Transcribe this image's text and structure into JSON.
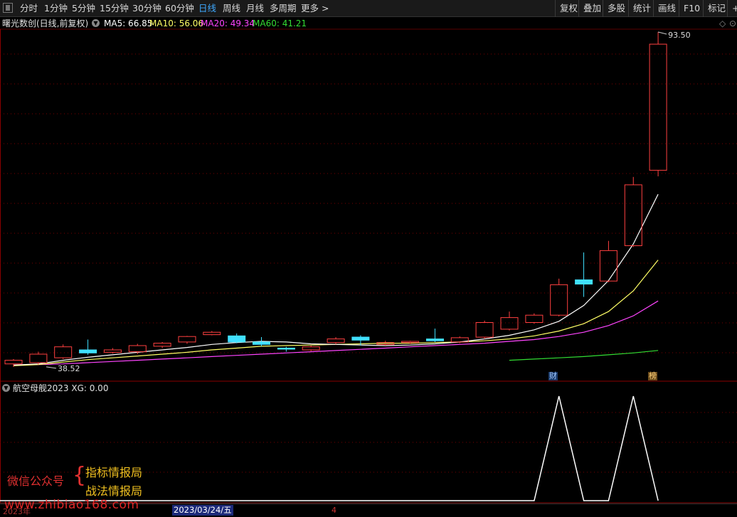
{
  "toolbar": {
    "periods": [
      "分时",
      "1分钟",
      "5分钟",
      "15分钟",
      "30分钟",
      "60分钟",
      "日线",
      "周线",
      "月线",
      "多周期",
      "更多 >"
    ],
    "active_period": "日线",
    "right_buttons": [
      "复权",
      "叠加",
      "多股",
      "统计",
      "画线",
      "F10",
      "标记",
      "+"
    ]
  },
  "stock": {
    "title": "曙光数创(日线,前复权)",
    "ma5": "MA5: 66.85",
    "ma10": "MA10: 56.06",
    "ma20": "MA20: 49.34",
    "ma60": "MA60: 41.21",
    "colors": {
      "ma5": "#ffffff",
      "ma10": "#ffff66",
      "ma20": "#ff44ff",
      "ma60": "#33dd33",
      "up": "#ff4040",
      "down": "#40e0ff",
      "grid": "#7a0000"
    }
  },
  "chart_data": {
    "type": "candlestick",
    "price_ylim": [
      36,
      96
    ],
    "high_label": "93.50",
    "low_label": "38.52",
    "candles": [
      {
        "o": 39.0,
        "c": 39.6,
        "h": 39.8,
        "l": 38.5
      },
      {
        "o": 39.2,
        "c": 40.6,
        "h": 41.0,
        "l": 38.9
      },
      {
        "o": 40.0,
        "c": 41.8,
        "h": 42.2,
        "l": 39.8
      },
      {
        "o": 41.3,
        "c": 40.8,
        "h": 43.0,
        "l": 40.5
      },
      {
        "o": 40.9,
        "c": 41.3,
        "h": 41.6,
        "l": 40.7
      },
      {
        "o": 41.0,
        "c": 42.0,
        "h": 42.3,
        "l": 40.6
      },
      {
        "o": 41.9,
        "c": 42.4,
        "h": 42.6,
        "l": 41.6
      },
      {
        "o": 42.6,
        "c": 43.5,
        "h": 43.6,
        "l": 42.3
      },
      {
        "o": 43.8,
        "c": 44.2,
        "h": 44.4,
        "l": 43.7
      },
      {
        "o": 43.6,
        "c": 42.6,
        "h": 44.0,
        "l": 42.4
      },
      {
        "o": 42.6,
        "c": 42.2,
        "h": 43.4,
        "l": 41.9
      },
      {
        "o": 41.6,
        "c": 41.5,
        "h": 41.8,
        "l": 41.0
      },
      {
        "o": 41.3,
        "c": 41.8,
        "h": 42.0,
        "l": 41.1
      },
      {
        "o": 42.5,
        "c": 43.1,
        "h": 43.4,
        "l": 42.2
      },
      {
        "o": 43.4,
        "c": 42.9,
        "h": 43.7,
        "l": 42.0
      },
      {
        "o": 42.2,
        "c": 42.5,
        "h": 42.8,
        "l": 42.0
      },
      {
        "o": 42.5,
        "c": 42.7,
        "h": 42.8,
        "l": 42.3
      },
      {
        "o": 43.1,
        "c": 42.8,
        "h": 44.8,
        "l": 42.6
      },
      {
        "o": 42.6,
        "c": 43.3,
        "h": 43.5,
        "l": 42.4
      },
      {
        "o": 43.4,
        "c": 45.8,
        "h": 46.1,
        "l": 43.1
      },
      {
        "o": 44.7,
        "c": 46.6,
        "h": 47.6,
        "l": 44.5
      },
      {
        "o": 45.8,
        "c": 47.0,
        "h": 47.3,
        "l": 45.6
      },
      {
        "o": 47.0,
        "c": 52.0,
        "h": 53.0,
        "l": 46.8
      },
      {
        "o": 52.8,
        "c": 52.1,
        "h": 57.3,
        "l": 50.0
      },
      {
        "o": 52.6,
        "c": 57.6,
        "h": 59.2,
        "l": 52.4
      },
      {
        "o": 58.4,
        "c": 68.4,
        "h": 69.7,
        "l": 58.2
      },
      {
        "o": 70.8,
        "c": 91.5,
        "h": 93.5,
        "l": 69.8
      }
    ],
    "ma5": [
      38.8,
      39.0,
      39.6,
      40.1,
      40.5,
      40.9,
      41.3,
      41.7,
      42.2,
      42.5,
      42.7,
      42.6,
      42.3,
      42.2,
      42.1,
      42.0,
      42.1,
      42.3,
      42.6,
      43.1,
      43.7,
      44.6,
      46.0,
      48.6,
      52.7,
      58.7,
      66.85
    ],
    "ma10": [
      38.7,
      38.9,
      39.3,
      39.7,
      40.0,
      40.3,
      40.6,
      40.9,
      41.3,
      41.6,
      41.9,
      42.0,
      42.1,
      42.2,
      42.3,
      42.4,
      42.4,
      42.5,
      42.6,
      42.8,
      43.1,
      43.6,
      44.4,
      45.6,
      47.6,
      51.0,
      56.06
    ],
    "ma20": [
      38.8,
      38.9,
      39.0,
      39.2,
      39.4,
      39.6,
      39.8,
      40.0,
      40.2,
      40.4,
      40.6,
      40.8,
      41.0,
      41.2,
      41.4,
      41.6,
      41.8,
      42.0,
      42.2,
      42.4,
      42.7,
      43.0,
      43.5,
      44.2,
      45.3,
      46.9,
      49.34
    ],
    "ma60": [
      null,
      null,
      null,
      null,
      null,
      null,
      null,
      null,
      null,
      null,
      null,
      null,
      null,
      null,
      null,
      null,
      null,
      null,
      null,
      null,
      39.6,
      39.8,
      40.0,
      40.2,
      40.5,
      40.8,
      41.21
    ],
    "xg_values": [
      0,
      0,
      0,
      0,
      0,
      0,
      0,
      0,
      0,
      0,
      0,
      0,
      0,
      0,
      0,
      0,
      0,
      0,
      0,
      0,
      0,
      0,
      1,
      0,
      0,
      1,
      0
    ]
  },
  "markers": {
    "cai": "财",
    "bang": "榜"
  },
  "indicator": {
    "title": "航空母舰2023  XG: 0.00"
  },
  "watermark": {
    "account_label": "微信公众号",
    "name1": "指标情报局",
    "name2": "战法情报局",
    "url": "www.zhibiao168.com"
  },
  "date_axis": {
    "left": "2023年",
    "highlight": "2023/03/24/五",
    "right": "4"
  }
}
